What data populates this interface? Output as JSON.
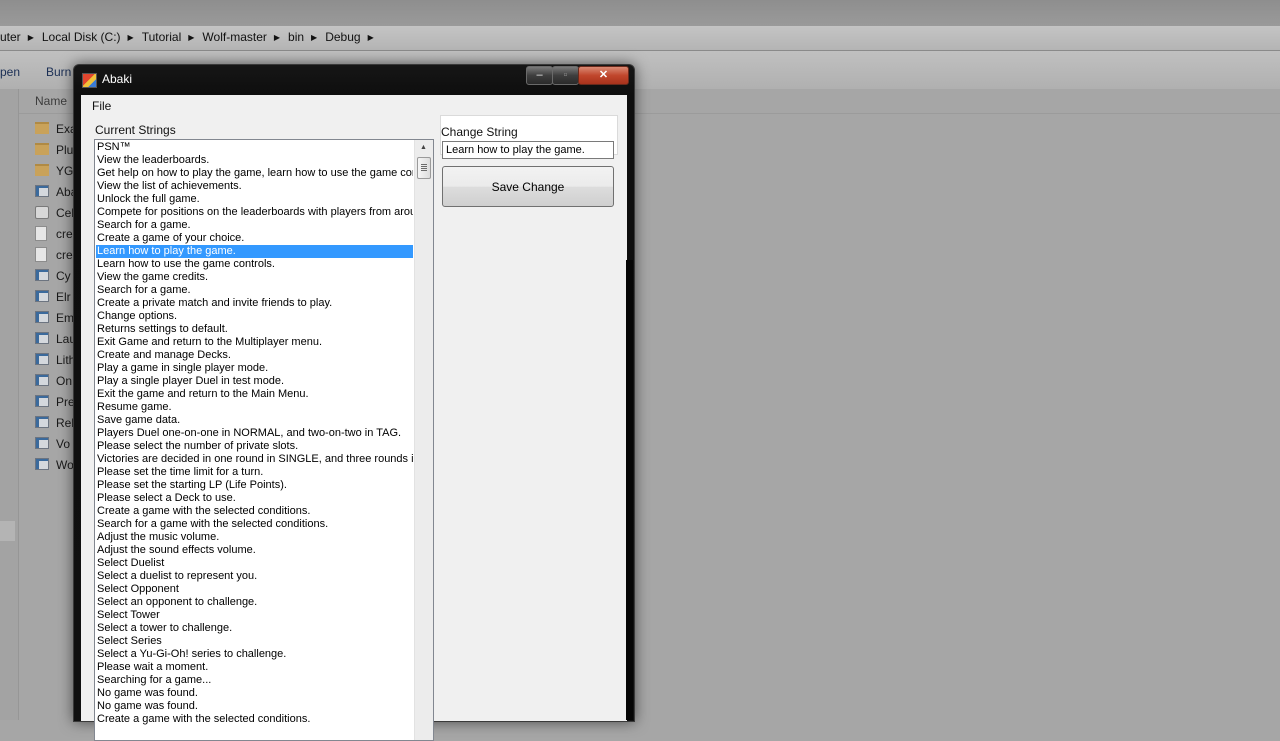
{
  "explorer": {
    "breadcrumbs": [
      "uter",
      "Local Disk (C:)",
      "Tutorial",
      "Wolf-master",
      "bin",
      "Debug"
    ],
    "toolbar": {
      "open": "pen",
      "burn": "Burn"
    },
    "column_name": "Name",
    "files": [
      {
        "name": "Exa",
        "icon": "folder-icon"
      },
      {
        "name": "Plu",
        "icon": "folder-icon"
      },
      {
        "name": "YG",
        "icon": "folder-icon"
      },
      {
        "name": "Aba",
        "icon": "application-icon"
      },
      {
        "name": "Cel",
        "icon": "dll-icon"
      },
      {
        "name": "cre",
        "icon": "document-icon"
      },
      {
        "name": "cre",
        "icon": "document-icon"
      },
      {
        "name": "Cy",
        "icon": "application-icon"
      },
      {
        "name": "Elr",
        "icon": "application-icon"
      },
      {
        "name": "Em",
        "icon": "application-icon"
      },
      {
        "name": "Lau",
        "icon": "application-icon"
      },
      {
        "name": "Lith",
        "icon": "application-icon"
      },
      {
        "name": "On",
        "icon": "application-icon"
      },
      {
        "name": "Pre",
        "icon": "application-icon"
      },
      {
        "name": "Rel",
        "icon": "application-icon"
      },
      {
        "name": "Vo",
        "icon": "application-icon"
      },
      {
        "name": "Wo",
        "icon": "application-icon"
      }
    ]
  },
  "window": {
    "title": "Abaki",
    "menu": {
      "file": "File"
    },
    "controls": {
      "minimize": "–",
      "maximize": "▫",
      "close": "✕"
    }
  },
  "main": {
    "current_strings_label": "Current Strings",
    "selected_index": 8,
    "strings": [
      "PSN™",
      "View the leaderboards.",
      "Get help on how to play the game, learn how to use the game contr",
      "View the list of achievements.",
      "Unlock the full game.",
      "Compete for positions on the leaderboards with players from around",
      "Search for a game.",
      "Create a game of your choice.",
      "Learn how to play the game.",
      "Learn how to use the game controls.",
      "View the game credits.",
      "Search for a game.",
      "Create a private match and invite friends to play.",
      "Change options.",
      "Returns settings to default.",
      "Exit Game and return to the Multiplayer menu.",
      "Create and manage Decks.",
      "Play a game in single player mode.",
      "Play a single player Duel in test mode.",
      "Exit the game and return to the Main Menu.",
      "Resume game.",
      "Save game data.",
      "Players Duel one-on-one in NORMAL, and two-on-two in TAG.",
      "Please select the number of private slots.",
      "Victories are decided in one round in SINGLE, and three rounds in I",
      "Please set the time limit for a turn.",
      "Please set the starting LP (Life Points).",
      "Please select a Deck to use.",
      "Create a game with the selected conditions.",
      "Search for a game with the selected conditions.",
      "Adjust the music volume.",
      "Adjust the sound effects volume.",
      "Select Duelist",
      "Select a duelist to represent you.",
      "Select Opponent",
      "Select an opponent to challenge.",
      "Select Tower",
      "Select a tower to challenge.",
      "Select Series",
      "Select a Yu-Gi-Oh! series to challenge.",
      "Please wait a moment.",
      "Searching for a game...",
      "No game was found.",
      "No game was found.",
      "Create a game with the selected conditions."
    ],
    "change_string_label": "Change String",
    "change_string_value": "Learn how to play the game.",
    "save_label": "Save Change"
  }
}
